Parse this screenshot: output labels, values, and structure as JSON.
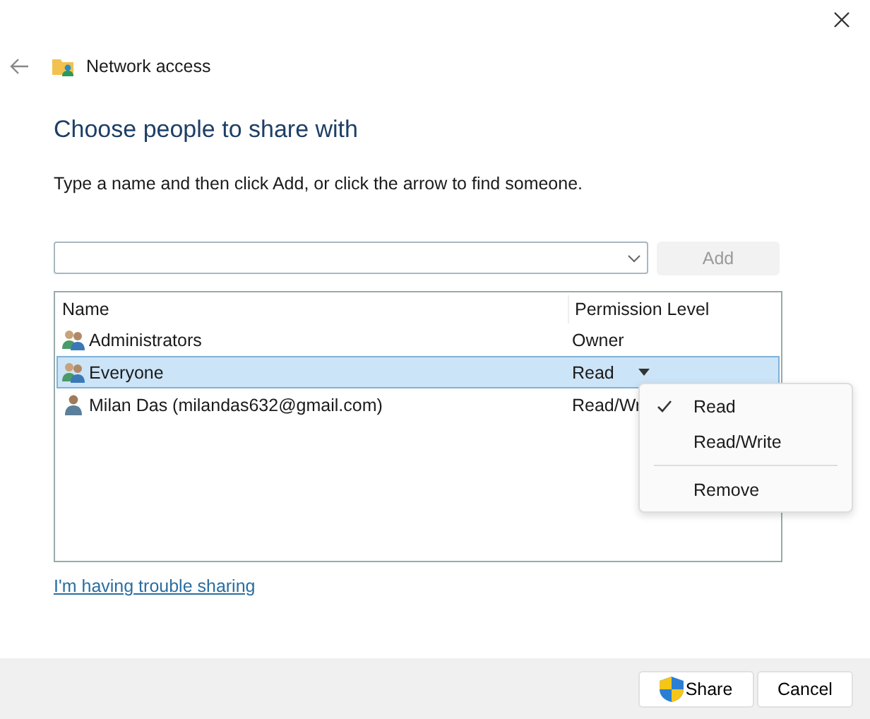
{
  "window": {
    "title": "Network access"
  },
  "heading": "Choose people to share with",
  "instruction": "Type a name and then click Add, or click the arrow to find someone.",
  "add_button": {
    "label": "Add",
    "disabled": true
  },
  "table": {
    "columns": [
      "Name",
      "Permission Level"
    ],
    "rows": [
      {
        "name": "Administrators",
        "permission": "Owner",
        "kind": "group",
        "selected": false
      },
      {
        "name": "Everyone",
        "permission": "Read",
        "kind": "group",
        "selected": true
      },
      {
        "name": "Milan Das (milandas632@gmail.com)",
        "permission": "Read/Wr",
        "kind": "user",
        "selected": false
      }
    ]
  },
  "menu": {
    "items": [
      {
        "kind": "option",
        "label": "Read",
        "checked": true
      },
      {
        "kind": "option",
        "label": "Read/Write",
        "checked": false
      },
      {
        "kind": "separator"
      },
      {
        "kind": "option",
        "label": "Remove",
        "checked": false
      }
    ]
  },
  "link": "I'm having trouble sharing",
  "buttons": [
    {
      "label": "Share",
      "kind": "shield"
    },
    {
      "label": "Cancel",
      "kind": "plain"
    }
  ]
}
